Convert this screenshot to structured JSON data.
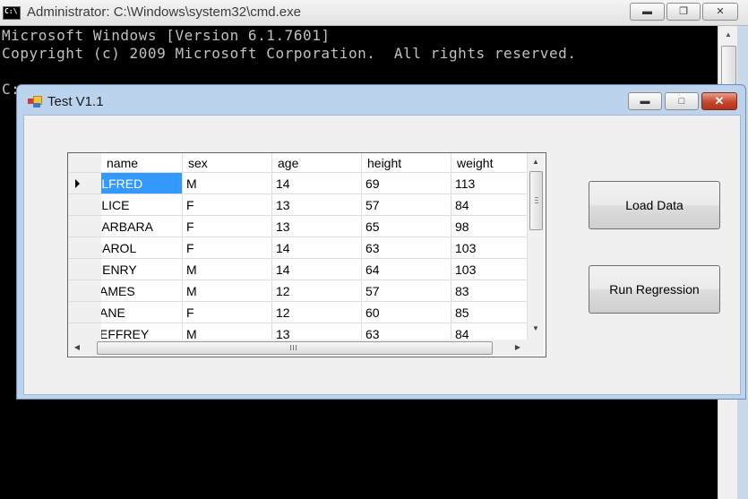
{
  "cmd": {
    "title": "Administrator: C:\\Windows\\system32\\cmd.exe",
    "lines": [
      "Microsoft Windows [Version 6.1.7601]",
      "Copyright (c) 2009 Microsoft Corporation.  All rights reserved.",
      "",
      "C:"
    ]
  },
  "form": {
    "title": "Test V1.1",
    "grid": {
      "columns": [
        "name",
        "sex",
        "age",
        "height",
        "weight"
      ],
      "rows": [
        [
          "ALFRED",
          "M",
          "14",
          "69",
          "113"
        ],
        [
          "ALICE",
          "F",
          "13",
          "57",
          "84"
        ],
        [
          "BARBARA",
          "F",
          "13",
          "65",
          "98"
        ],
        [
          "CAROL",
          "F",
          "14",
          "63",
          "103"
        ],
        [
          "HENRY",
          "M",
          "14",
          "64",
          "103"
        ],
        [
          "JAMES",
          "M",
          "12",
          "57",
          "83"
        ],
        [
          "JANE",
          "F",
          "12",
          "60",
          "85"
        ],
        [
          "JEFFREY",
          "M",
          "13",
          "63",
          "84"
        ]
      ],
      "selected_row": 0
    },
    "buttons": {
      "load_label": "Load Data",
      "run_label": "Run Regression"
    }
  },
  "icons": {
    "minimize": "minimize-icon",
    "maximize": "maximize-icon",
    "restore": "restore-icon",
    "close": "close-icon",
    "row_pointer": "row-pointer-icon"
  },
  "colors": {
    "selection": "#3399ff",
    "close_button": "#c8442b",
    "form_frame": "#bcd3ee"
  }
}
